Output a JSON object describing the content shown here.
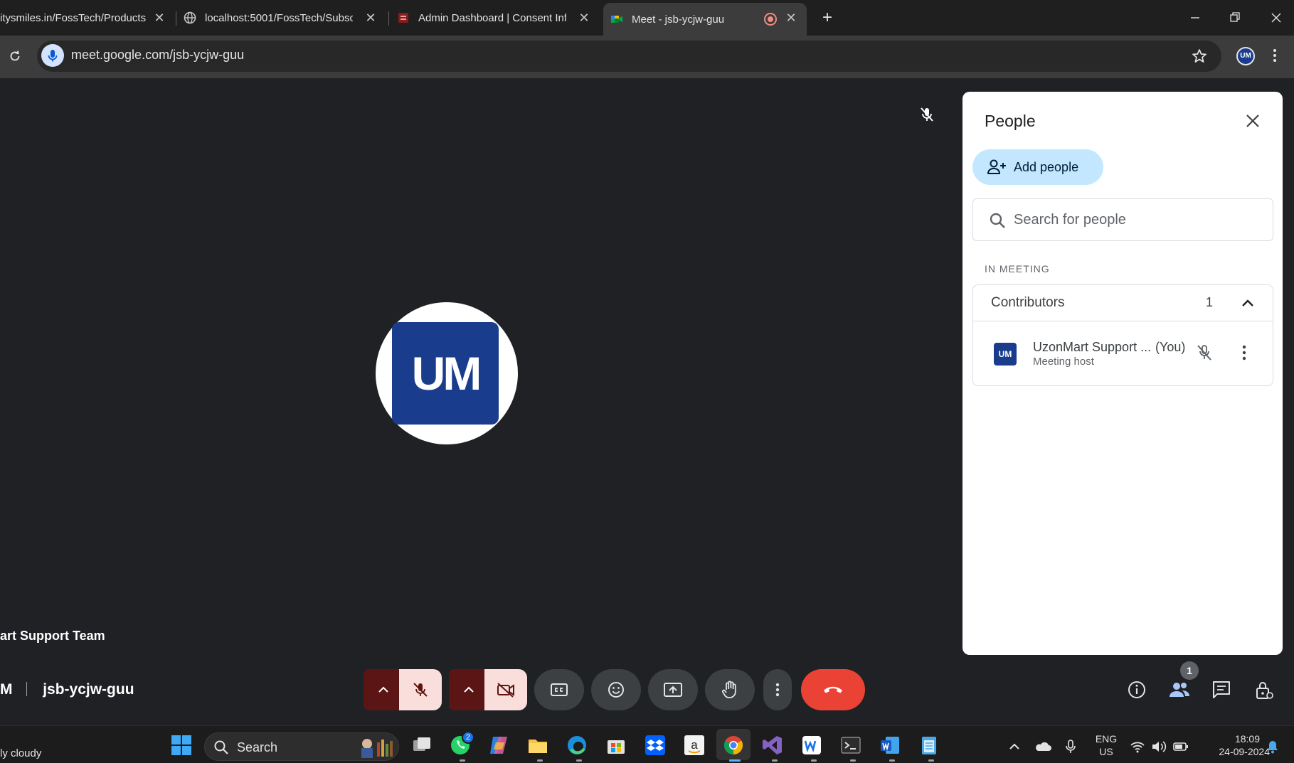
{
  "browser": {
    "tabs": [
      {
        "title": "itysmiles.in/FossTech/Products",
        "active": false
      },
      {
        "title": "localhost:5001/FossTech/Subscri",
        "active": false
      },
      {
        "title": "Admin Dashboard | Consent Inf",
        "active": false
      },
      {
        "title": "Meet - jsb-ycjw-guu",
        "active": true
      }
    ],
    "close_glyph": "✕",
    "new_tab_glyph": "+",
    "url": "meet.google.com/jsb-ycjw-guu",
    "profile_initials": "UM"
  },
  "meet": {
    "avatar_initials": "UM",
    "participant_name": "art Support Team",
    "meeting_code_prefix": "M",
    "meeting_code": "jsb-ycjw-guu",
    "people_badge": "1",
    "controls": [
      "mic-off",
      "camera-off",
      "captions",
      "emoji",
      "present",
      "raise-hand",
      "more",
      "leave-call"
    ],
    "colors": {
      "background": "#202124",
      "hangup": "#ea4335",
      "danger_bg": "#f9dedc",
      "accent_chip": "#c2e7ff"
    }
  },
  "people_panel": {
    "title": "People",
    "add_people_label": "Add people",
    "search_placeholder": "Search for people",
    "section_label": "IN MEETING",
    "group_label": "Contributors",
    "group_count": "1",
    "participant": {
      "initials": "UM",
      "name": "UzonMart Support ...",
      "you_label": "(You)",
      "role": "Meeting host"
    }
  },
  "taskbar": {
    "weather": "ly cloudy",
    "search_label": "Search",
    "whatsapp_badge": "2",
    "language_top": "ENG",
    "language_bottom": "US",
    "time": "18:09",
    "date": "24-09-2024"
  }
}
